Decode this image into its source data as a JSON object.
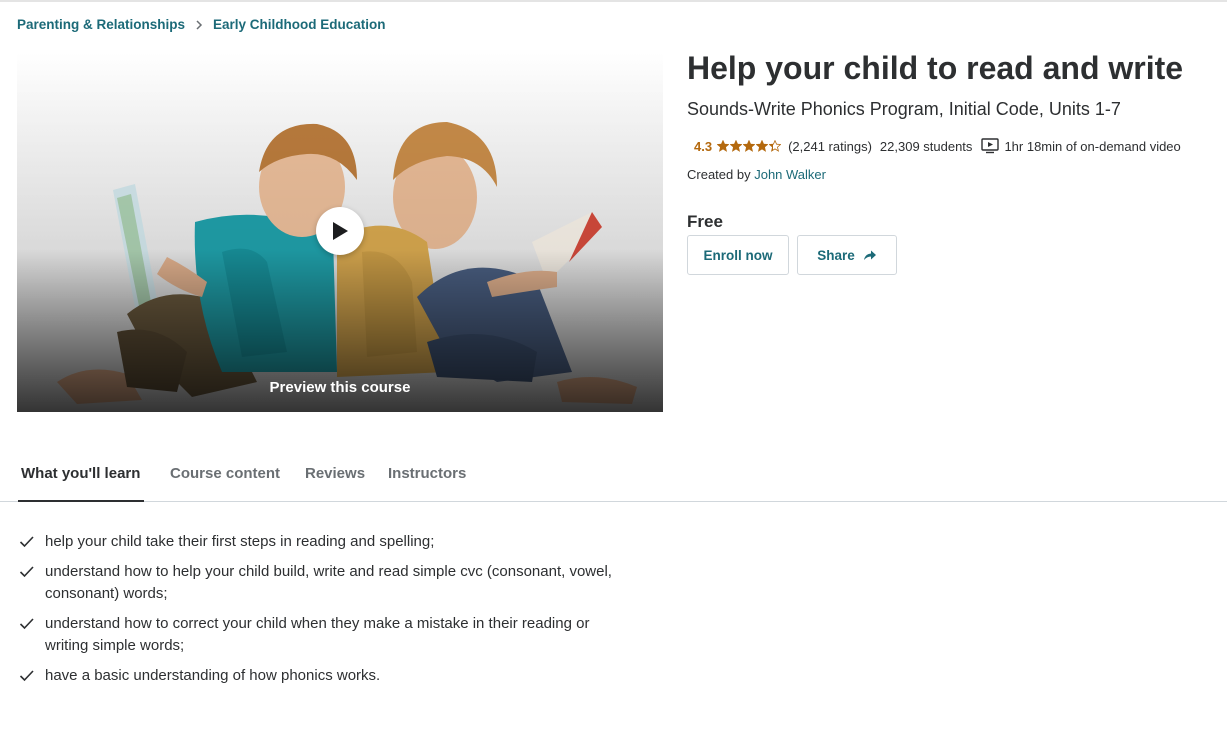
{
  "breadcrumb": {
    "items": [
      "Parenting & Relationships",
      "Early Childhood Education"
    ],
    "separator_icon": "chevron-right-icon"
  },
  "preview": {
    "label": "Preview this course",
    "play_icon": "play-icon"
  },
  "course": {
    "title": "Help your child to read and write",
    "subtitle": "Sounds-Write Phonics Program, Initial Code, Units 1-7",
    "rating": "4.3",
    "rating_value": 4.3,
    "ratings_count": "(2,241 ratings)",
    "students": "22,309 students",
    "video_icon": "video-icon",
    "video_length": "1hr 18min of on-demand video",
    "created_by_label": "Created by",
    "instructor": "John Walker",
    "price": "Free"
  },
  "actions": {
    "enroll_label": "Enroll now",
    "share_label": "Share",
    "share_icon": "share-arrow-icon"
  },
  "tabs": [
    {
      "label": "What you'll learn",
      "active": true
    },
    {
      "label": "Course content",
      "active": false
    },
    {
      "label": "Reviews",
      "active": false
    },
    {
      "label": "Instructors",
      "active": false
    }
  ],
  "learn_items": [
    "help your child take their first steps in reading and spelling;",
    "understand how to help your child build, write and read simple cvc (consonant, vowel, consonant) words;",
    "understand how to correct your child when they make a mistake in their reading or writing simple words;",
    "have a basic understanding of how phonics works."
  ],
  "colors": {
    "link": "#1c6a78",
    "rating": "#b4690e",
    "text": "#2d2f31",
    "muted": "#6a6f73",
    "border": "#d1d7dc"
  }
}
